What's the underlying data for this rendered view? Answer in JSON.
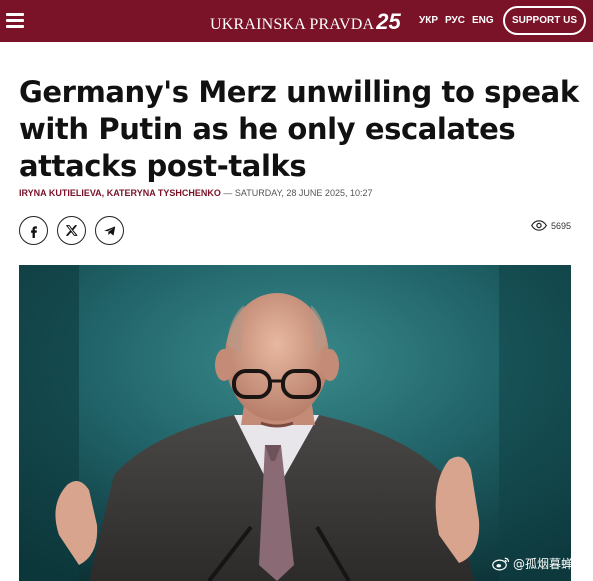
{
  "header": {
    "logo_text": "UKRAINSKA PRAVDA",
    "logo_number": "25",
    "languages": [
      "УКР",
      "РУС",
      "ENG"
    ],
    "support_label": "SUPPORT US"
  },
  "article": {
    "headline_lines": [
      "Germany's Merz unwilling to speak",
      "with Putin as he only escalates",
      "attacks post-talks"
    ],
    "authors": [
      "IRYNA KUTIELIEVA",
      "KATERYNA TYSHCHENKO"
    ],
    "author_separator": ",",
    "date_separator": "—",
    "date": "SATURDAY, 28 JUNE 2025, 10:27",
    "views": "5695"
  },
  "share_buttons": [
    "facebook-icon",
    "x-icon",
    "telegram-icon"
  ],
  "photo": {
    "watermark": "@孤烟暮蝉"
  },
  "colors": {
    "brand": "#7a1228",
    "text": "#111111"
  }
}
